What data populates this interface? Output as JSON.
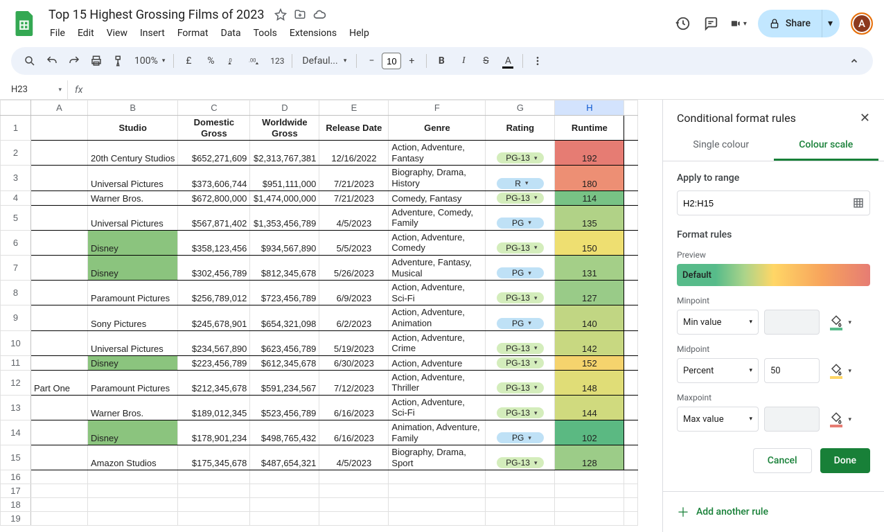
{
  "doc": {
    "title": "Top 15 Highest Grossing Films of 2023"
  },
  "menu": {
    "file": "File",
    "edit": "Edit",
    "view": "View",
    "insert": "Insert",
    "format": "Format",
    "data": "Data",
    "tools": "Tools",
    "extensions": "Extensions",
    "help": "Help"
  },
  "toolbar": {
    "zoom": "100%",
    "currency": "£",
    "percent": "%",
    "format123": "123",
    "font": "Defaul...",
    "fontsize": "10",
    "share": "Share"
  },
  "avatar": {
    "initial": "A"
  },
  "namebox": {
    "ref": "H23"
  },
  "columns": {
    "A": "A",
    "B": "B",
    "C": "C",
    "D": "D",
    "E": "E",
    "F": "F",
    "G": "G",
    "H": "H"
  },
  "colwidths": {
    "A": 82,
    "B": 130,
    "C": 104,
    "D": 100,
    "E": 100,
    "F": 140,
    "G": 100,
    "H": 100
  },
  "headers": {
    "studio": "Studio",
    "domestic": "Domestic Gross",
    "worldwide": "Worldwide Gross",
    "release": "Release Date",
    "genre": "Genre",
    "rating": "Rating",
    "runtime": "Runtime"
  },
  "rows": [
    {
      "n": "2",
      "a": "",
      "studio": "20th Century Studios",
      "dom": "$652,271,609",
      "ww": "$2,313,767,381",
      "rel": "12/16/2022",
      "genre": "Action, Adventure, Fantasy",
      "rating": "PG-13",
      "rchip": "green",
      "rt": "192",
      "rtc": "rt-192",
      "sc": ""
    },
    {
      "n": "3",
      "a": "",
      "studio": "Universal Pictures",
      "dom": "$373,606,744",
      "ww": "$951,111,000",
      "rel": "7/21/2023",
      "genre": "Biography, Drama, History",
      "rating": "R",
      "rchip": "blue",
      "rt": "180",
      "rtc": "rt-180",
      "sc": ""
    },
    {
      "n": "4",
      "a": "",
      "studio": "Warner Bros.",
      "dom": "$672,800,000",
      "ww": "$1,474,000,000",
      "rel": "7/21/2023",
      "genre": "Comedy, Fantasy",
      "rating": "PG-13",
      "rchip": "green",
      "rt": "114",
      "rtc": "rt-114",
      "sc": ""
    },
    {
      "n": "5",
      "a": "",
      "studio": "Universal Pictures",
      "dom": "$567,871,402",
      "ww": "$1,353,456,789",
      "rel": "4/5/2023",
      "genre": "Adventure, Comedy, Family",
      "rating": "PG",
      "rchip": "blue",
      "rt": "135",
      "rtc": "rt-135",
      "sc": ""
    },
    {
      "n": "6",
      "a": "",
      "studio": "Disney",
      "dom": "$358,123,456",
      "ww": "$934,567,890",
      "rel": "5/5/2023",
      "genre": "Action, Adventure, Comedy",
      "rating": "PG-13",
      "rchip": "green",
      "rt": "150",
      "rtc": "rt-150",
      "sc": "bg-green-dark"
    },
    {
      "n": "7",
      "a": "",
      "studio": "Disney",
      "dom": "$302,456,789",
      "ww": "$812,345,678",
      "rel": "5/26/2023",
      "genre": "Adventure, Fantasy, Musical",
      "rating": "PG",
      "rchip": "blue",
      "rt": "131",
      "rtc": "rt-131",
      "sc": "bg-green-dark"
    },
    {
      "n": "8",
      "a": "",
      "studio": "Paramount Pictures",
      "dom": "$256,789,012",
      "ww": "$723,456,789",
      "rel": "6/9/2023",
      "genre": "Action, Adventure, Sci-Fi",
      "rating": "PG-13",
      "rchip": "green",
      "rt": "127",
      "rtc": "rt-127",
      "sc": ""
    },
    {
      "n": "9",
      "a": "",
      "studio": "Sony Pictures",
      "dom": "$245,678,901",
      "ww": "$654,321,098",
      "rel": "6/2/2023",
      "genre": "Action, Adventure, Animation",
      "rating": "PG",
      "rchip": "blue",
      "rt": "140",
      "rtc": "rt-140",
      "sc": ""
    },
    {
      "n": "10",
      "a": "",
      "studio": "Universal Pictures",
      "dom": "$234,567,890",
      "ww": "$623,456,789",
      "rel": "5/19/2023",
      "genre": "Action, Adventure, Crime",
      "rating": "PG-13",
      "rchip": "green",
      "rt": "142",
      "rtc": "rt-142",
      "sc": ""
    },
    {
      "n": "11",
      "a": "",
      "studio": "Disney",
      "dom": "$223,456,789",
      "ww": "$612,345,678",
      "rel": "6/30/2023",
      "genre": "Action, Adventure",
      "rating": "PG-13",
      "rchip": "green",
      "rt": "152",
      "rtc": "rt-152",
      "sc": "bg-green-dark"
    },
    {
      "n": "12",
      "a": "Part One",
      "studio": "Paramount Pictures",
      "dom": "$212,345,678",
      "ww": "$591,234,567",
      "rel": "7/12/2023",
      "genre": "Action, Adventure, Thriller",
      "rating": "PG-13",
      "rchip": "green",
      "rt": "148",
      "rtc": "rt-148",
      "sc": ""
    },
    {
      "n": "13",
      "a": "",
      "studio": "Warner Bros.",
      "dom": "$189,012,345",
      "ww": "$523,456,789",
      "rel": "6/16/2023",
      "genre": "Action, Adventure, Sci-Fi",
      "rating": "PG-13",
      "rchip": "green",
      "rt": "144",
      "rtc": "rt-144",
      "sc": ""
    },
    {
      "n": "14",
      "a": "",
      "studio": "Disney",
      "dom": "$178,901,234",
      "ww": "$498,765,432",
      "rel": "6/16/2023",
      "genre": "Animation, Adventure, Family",
      "rating": "PG",
      "rchip": "blue",
      "rt": "102",
      "rtc": "rt-102",
      "sc": "bg-green-dark"
    },
    {
      "n": "15",
      "a": "",
      "studio": "Amazon Studios",
      "dom": "$175,345,678",
      "ww": "$487,654,321",
      "rel": "4/5/2023",
      "genre": "Biography, Drama, Sport",
      "rating": "PG-13",
      "rchip": "green",
      "rt": "128",
      "rtc": "rt-128",
      "sc": ""
    }
  ],
  "emptyrows": [
    "16",
    "17",
    "18",
    "19"
  ],
  "sidebar": {
    "title": "Conditional format rules",
    "tab1": "Single colour",
    "tab2": "Colour scale",
    "apply": "Apply to range",
    "range": "H2:H15",
    "rules": "Format rules",
    "preview": "Preview",
    "default": "Default",
    "min": "Minpoint",
    "minval": "Min value",
    "mid": "Midpoint",
    "midval": "Percent",
    "midnum": "50",
    "max": "Maxpoint",
    "maxval": "Max value",
    "cancel": "Cancel",
    "done": "Done",
    "add": "Add another rule"
  }
}
